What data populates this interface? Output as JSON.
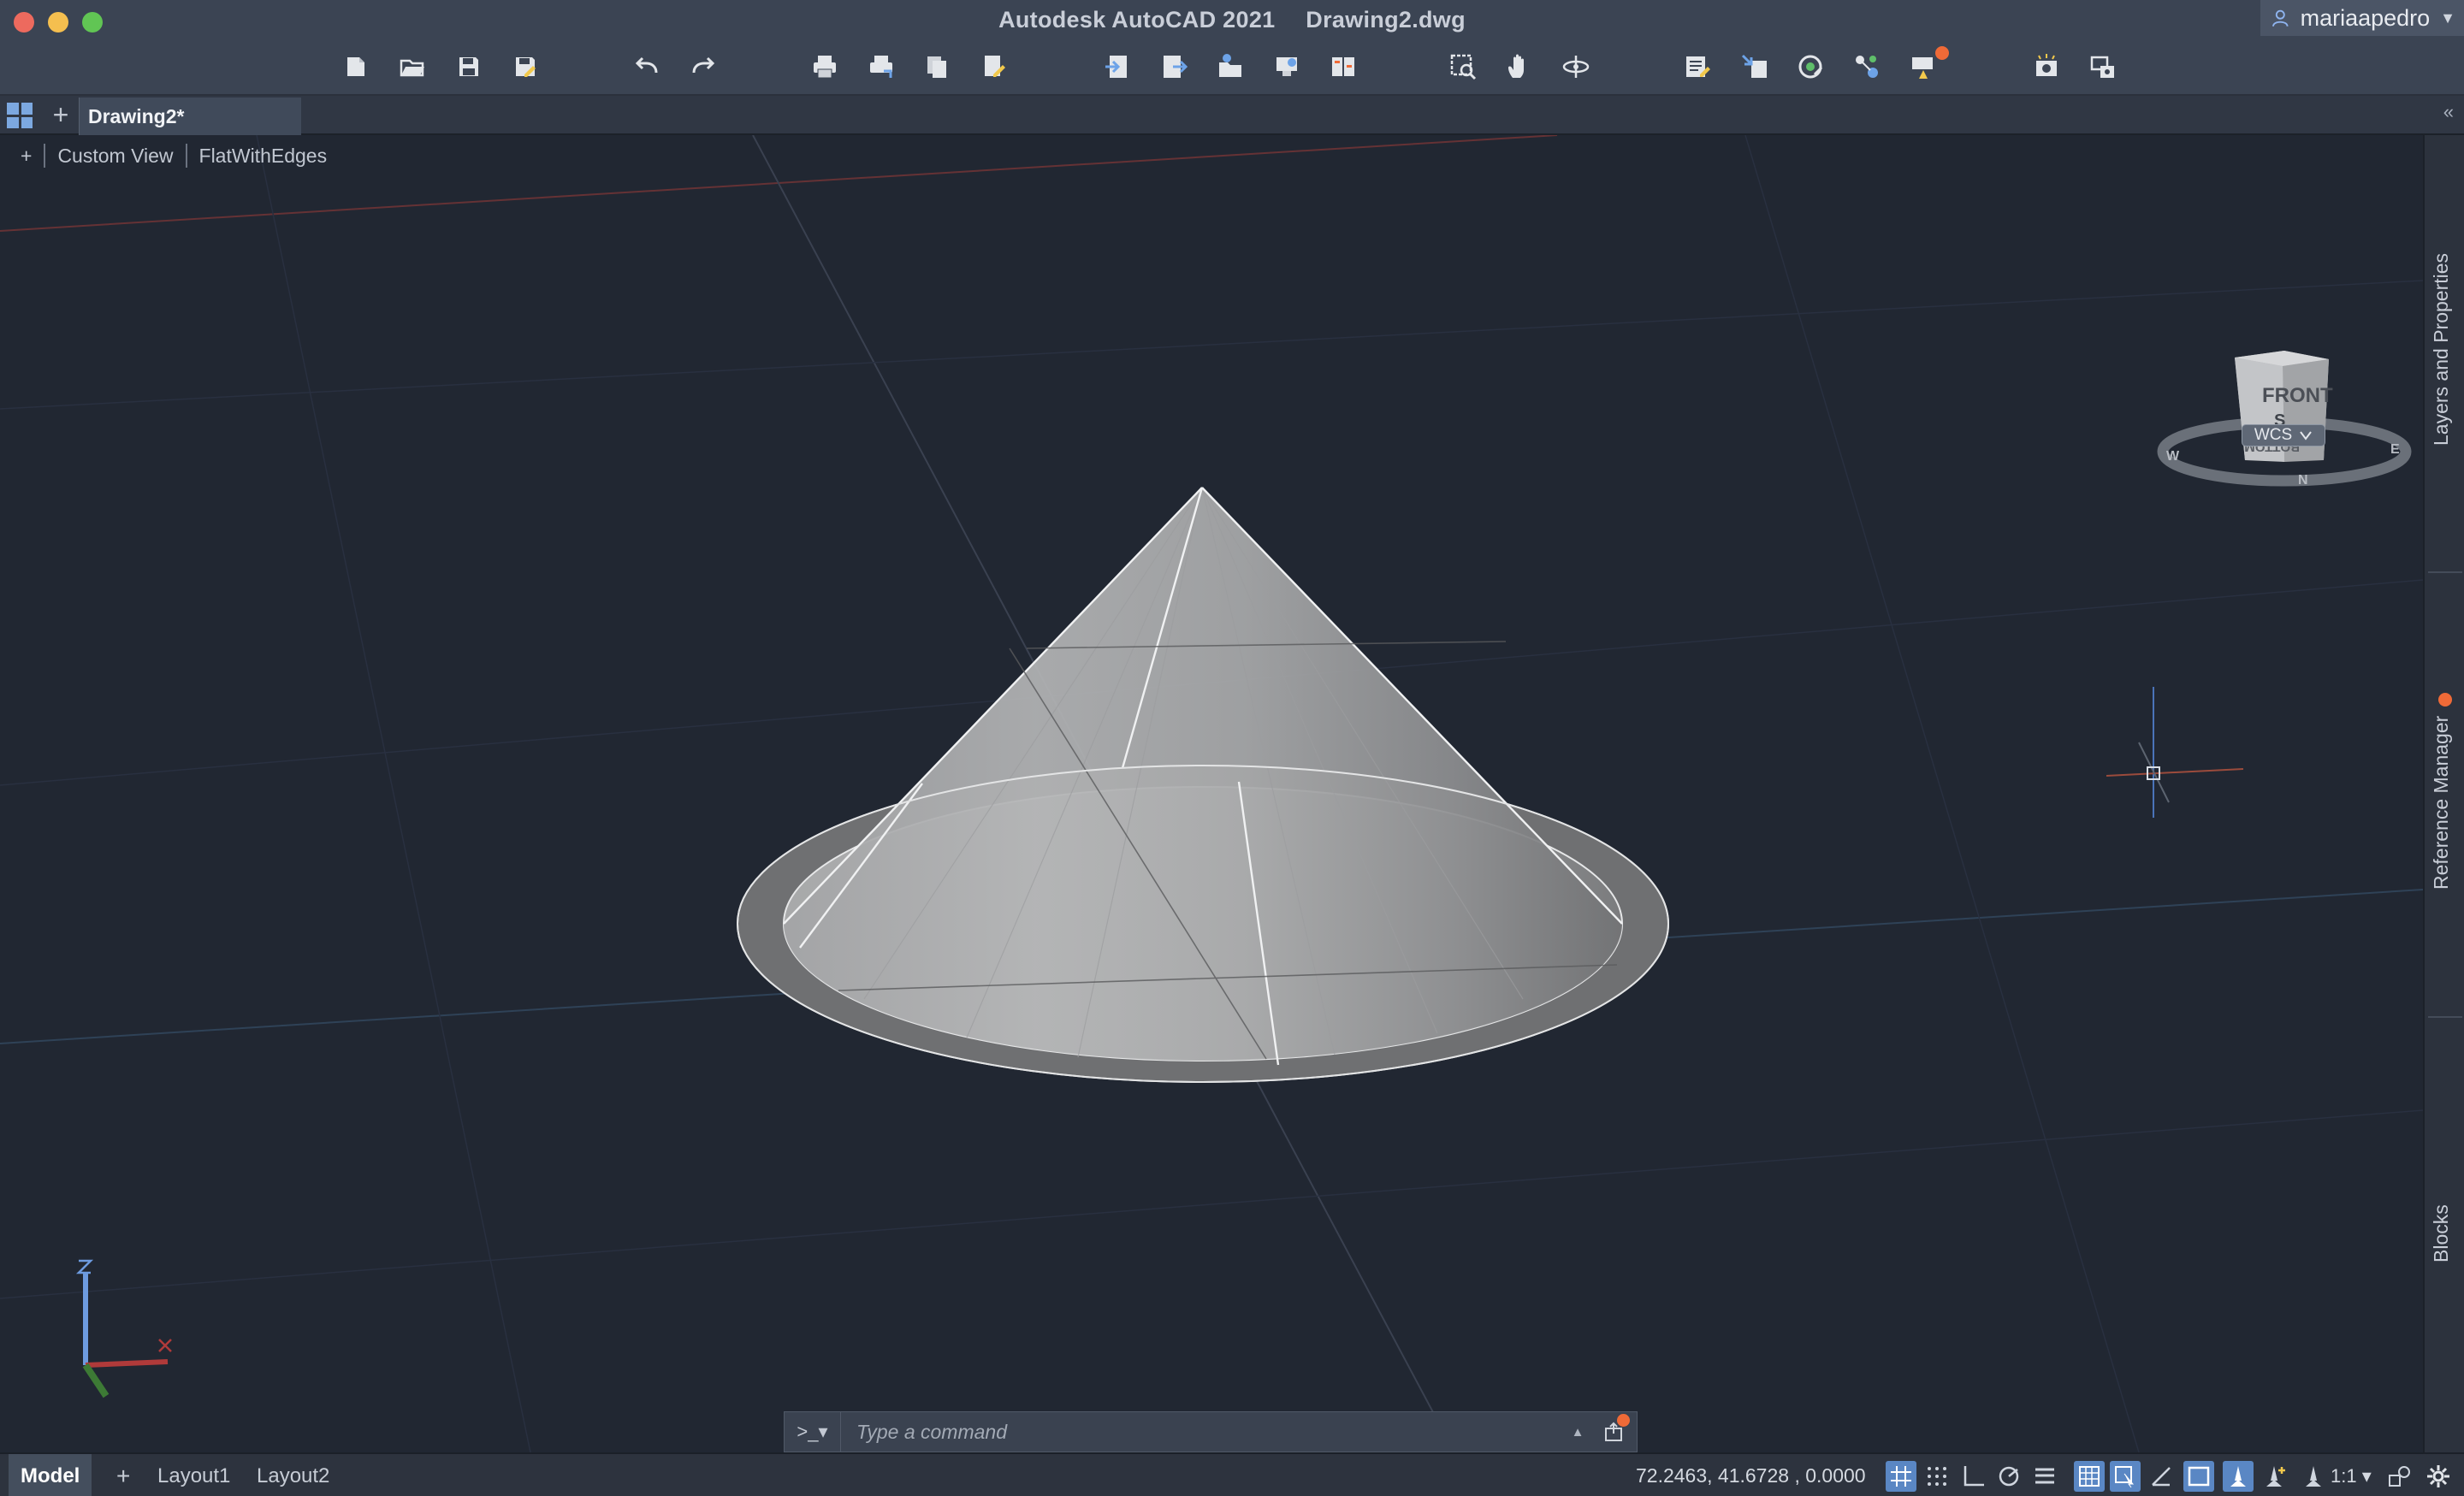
{
  "window": {
    "app_name": "Autodesk AutoCAD 2021",
    "file_name": "Drawing2.dwg",
    "user_name": "mariaapedro"
  },
  "toolbar": {
    "icons": [
      "new-icon",
      "open-icon",
      "save-icon",
      "save-as-icon",
      "undo-icon",
      "redo-icon",
      "plot-icon",
      "batch-plot-icon",
      "publish-icon",
      "page-setup-icon",
      "import-icon",
      "export-icon",
      "attach-icon",
      "share-icon",
      "compare-icon",
      "zoom-window-icon",
      "pan-icon",
      "orbit-icon",
      "properties-icon",
      "match-properties-icon",
      "xref-icon",
      "layers-icon",
      "alerts-icon",
      "render-icon",
      "view-manager-icon"
    ]
  },
  "tabs": {
    "active_tab": "Drawing2*"
  },
  "viewport": {
    "controls_plus": "+",
    "view_label": "Custom View",
    "visual_style": "FlatWithEdges",
    "wcs_label": "WCS",
    "navcube_face": "FRONT",
    "navcube_bottom": "BOTTOM",
    "compass": {
      "south": "S",
      "north": "N",
      "east": "E",
      "west": "W"
    },
    "ucs_z": "Z",
    "object": "cone-solid",
    "accent_red": "#b03a3a",
    "accent_blue": "#6d9be0"
  },
  "palettes": {
    "layers": "Layers and Properties",
    "reference": "Reference Manager",
    "blocks": "Blocks"
  },
  "command": {
    "prompt": ">_▾",
    "placeholder": "Type a command"
  },
  "status": {
    "layouts": [
      "Model",
      "Layout1",
      "Layout2"
    ],
    "add_layout": "+",
    "coordinates": "72.2463, 41.6728 , 0.0000",
    "scale": "1:1 ▾"
  }
}
